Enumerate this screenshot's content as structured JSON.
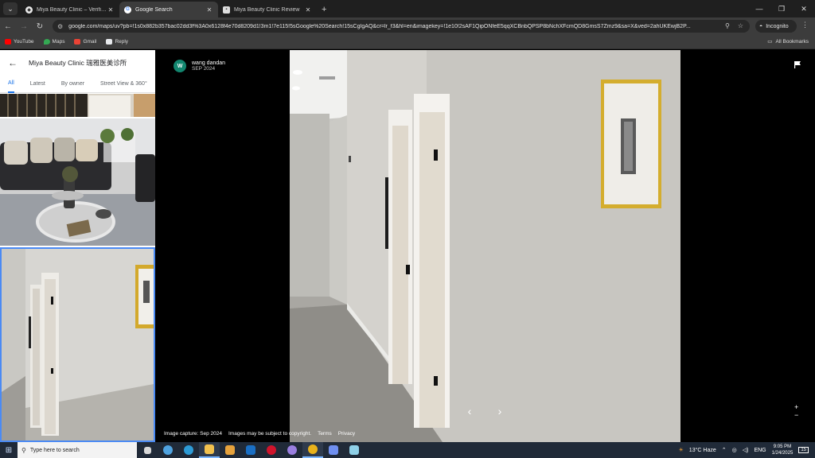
{
  "browser": {
    "tabs": [
      {
        "title": "Miya Beauty Clinic – Verified Cu",
        "favicon": "shield-icon",
        "active": false
      },
      {
        "title": "Google Search",
        "favicon": "google-icon",
        "active": true
      },
      {
        "title": "Miya Beauty Clinic Review",
        "favicon": "page-icon",
        "active": false
      }
    ],
    "url": "google.com/maps/uv?pb=!1s0x882b357bac02dd3f%3A0x6128f4e70d8209d1!3m1!7e115!5sGoogle%20Search!15sCgIgAQ&cr=lr_f3&hl=en&imagekey=!1e10!2sAF1QipONfeE5qqXCBnbQPSP8bNchXFcmQD8GmsS7Zmz9&sa=X&ved=2ahUKEwjB2P...",
    "incognito_label": "Incognito",
    "bookmarks": [
      {
        "label": "YouTube",
        "icon": "youtube-icon",
        "color": "#ff0000"
      },
      {
        "label": "Maps",
        "icon": "maps-icon",
        "color": "#34a853"
      },
      {
        "label": "Gmail",
        "icon": "gmail-icon",
        "color": "#ea4335"
      },
      {
        "label": "Reply",
        "icon": "reply-icon",
        "color": "#e8eaed"
      }
    ],
    "all_bookmarks": "All Bookmarks"
  },
  "panel": {
    "title": "Miya Beauty Clinic 瑞雅医美诊所",
    "tabs": [
      "All",
      "Latest",
      "By owner",
      "Street View & 360°"
    ],
    "active_tab": "All"
  },
  "viewer": {
    "author_initial": "W",
    "author_name": "wang dandan",
    "author_date": "SEP 2024",
    "footer": [
      "Image capture: Sep 2024",
      "Images may be subject to copyright.",
      "Terms",
      "Privacy"
    ],
    "zoom_in": "+",
    "zoom_out": "−"
  },
  "taskbar": {
    "search_placeholder": "Type here to search",
    "weather": "13°C  Haze",
    "language": "ENG",
    "time": "9:05 PM",
    "date": "1/24/2025",
    "notifications": "15"
  }
}
